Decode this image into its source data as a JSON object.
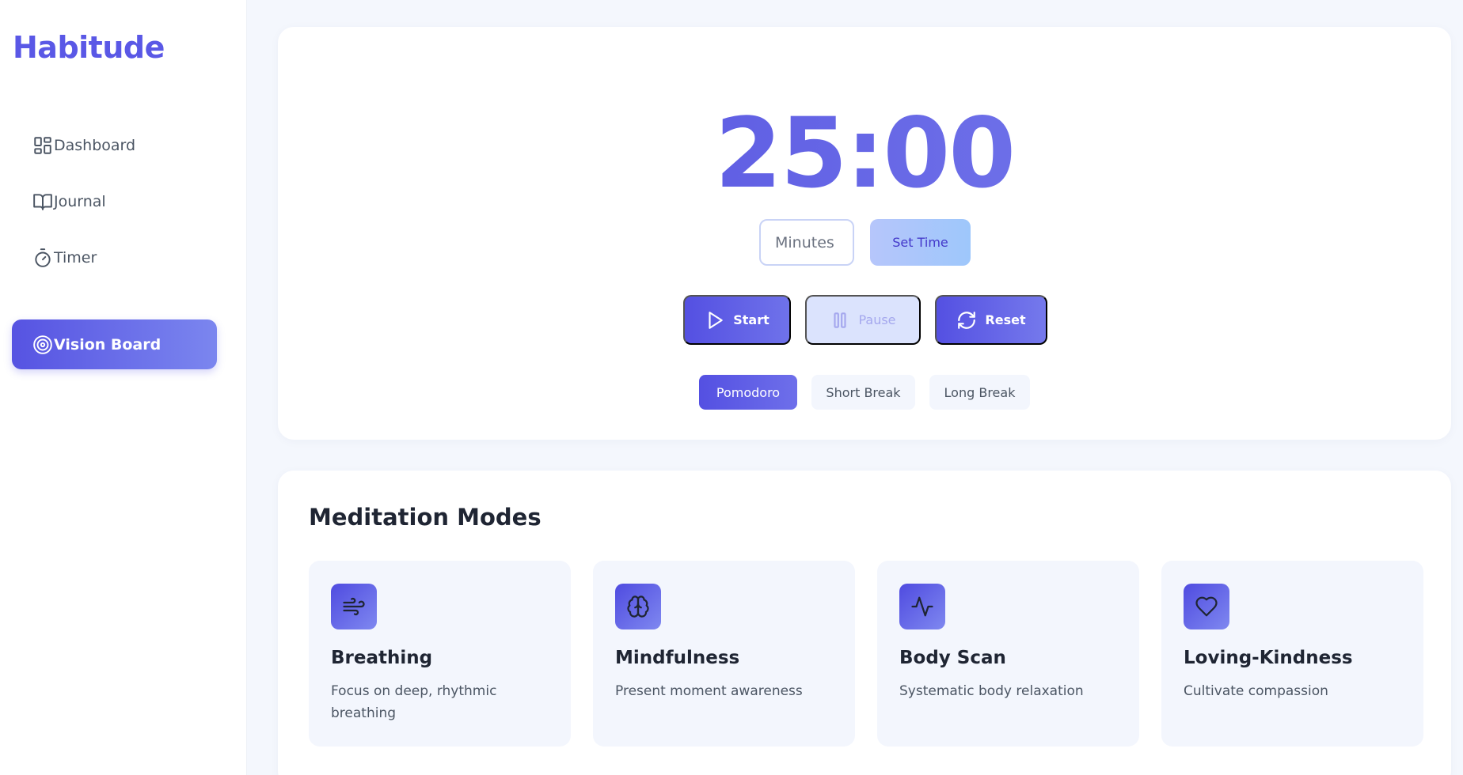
{
  "app": {
    "name": "Habitude"
  },
  "sidebar": {
    "items": [
      {
        "label": "Dashboard",
        "icon": "dashboard-icon",
        "active": false
      },
      {
        "label": "Journal",
        "icon": "book-icon",
        "active": false
      },
      {
        "label": "Timer",
        "icon": "timer-icon",
        "active": false
      },
      {
        "label": "Vision Board",
        "icon": "target-icon",
        "active": true
      }
    ]
  },
  "timer": {
    "display": "25:00",
    "minutes_placeholder": "Minutes",
    "set_time_label": "Set Time",
    "controls": {
      "start_label": "Start",
      "pause_label": "Pause",
      "reset_label": "Reset"
    },
    "modes": [
      {
        "label": "Pomodoro",
        "active": true
      },
      {
        "label": "Short Break",
        "active": false
      },
      {
        "label": "Long Break",
        "active": false
      }
    ]
  },
  "meditation": {
    "title": "Meditation Modes",
    "modes": [
      {
        "title": "Breathing",
        "description": "Focus on deep, rhythmic breathing",
        "icon": "wind-icon"
      },
      {
        "title": "Mindfulness",
        "description": "Present moment awareness",
        "icon": "brain-icon"
      },
      {
        "title": "Body Scan",
        "description": "Systematic body relaxation",
        "icon": "activity-icon"
      },
      {
        "title": "Loving-Kindness",
        "description": "Cultivate compassion",
        "icon": "heart-icon"
      }
    ]
  },
  "colors": {
    "accent": "#5a58e6",
    "background": "#f4f7fd",
    "text_dark": "#1f2533",
    "text_muted": "#4b5563"
  }
}
